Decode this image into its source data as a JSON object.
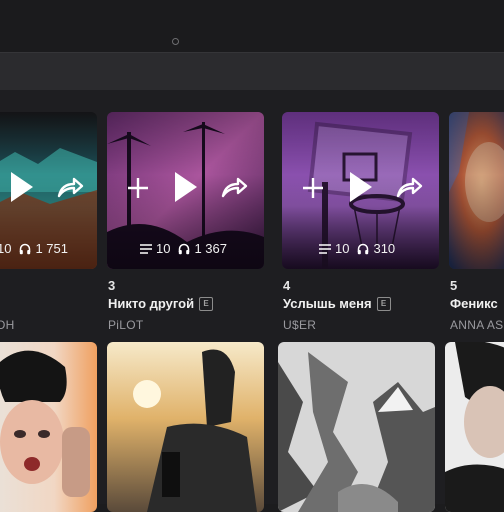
{
  "colors": {
    "background": "#1e1e21",
    "accent_text": "#f0f0f0",
    "muted_text": "#9a9a9f"
  },
  "cards": [
    {
      "track_count": "10",
      "listens": "1 751",
      "rank": "",
      "title": "",
      "artist": "OH"
    },
    {
      "track_count": "10",
      "listens": "1 367",
      "rank": "3",
      "title": "Никто другой",
      "explicit": "E",
      "artist": "PiLOT"
    },
    {
      "track_count": "10",
      "listens": "310",
      "rank": "4",
      "title": "Услышь меня",
      "explicit": "E",
      "artist": "U$ER"
    },
    {
      "track_count": "",
      "listens": "",
      "rank": "5",
      "title": "Феникс",
      "artist": "ANNA AS"
    }
  ]
}
